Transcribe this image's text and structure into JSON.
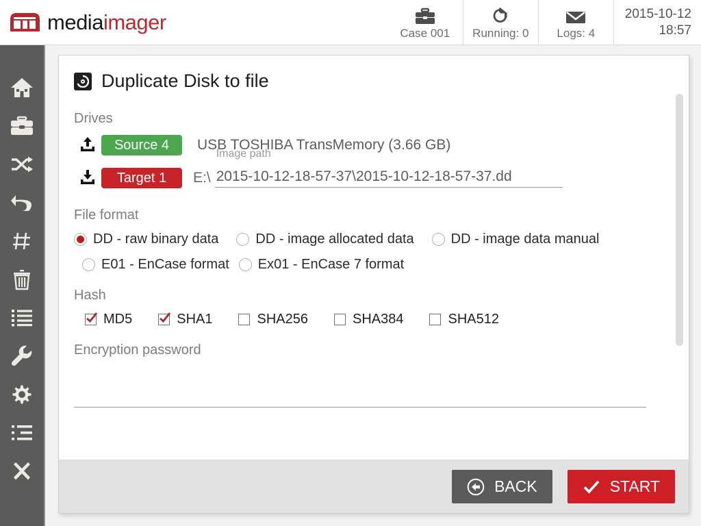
{
  "brand": {
    "name_part1": "media",
    "name_part2": "imager",
    "logo_icon": "mediaimager-logo-icon",
    "red": "#c0282f",
    "dark": "#1a1a1a"
  },
  "header": {
    "items": [
      {
        "icon": "briefcase-icon",
        "label": "Case 001"
      },
      {
        "icon": "running-refresh-icon",
        "label": "Running: 0"
      },
      {
        "icon": "envelope-icon",
        "label": "Logs: 4"
      }
    ],
    "clock": {
      "date": "2015-10-12",
      "time": "18:57"
    }
  },
  "sidebar": {
    "items": [
      {
        "icon": "home-icon",
        "name": "sidebar-item-home"
      },
      {
        "icon": "briefcase-icon",
        "name": "sidebar-item-case"
      },
      {
        "icon": "shuffle-icon",
        "name": "sidebar-item-duplicate"
      },
      {
        "icon": "undo-icon",
        "name": "sidebar-item-restore"
      },
      {
        "icon": "hash-icon",
        "name": "sidebar-item-hash"
      },
      {
        "icon": "trash-icon",
        "name": "sidebar-item-wipe"
      },
      {
        "icon": "list-icon",
        "name": "sidebar-item-logs"
      },
      {
        "icon": "wrench-icon",
        "name": "sidebar-item-tools"
      },
      {
        "icon": "gear-icon",
        "name": "sidebar-item-settings"
      },
      {
        "icon": "sliders-icon",
        "name": "sidebar-item-preferences"
      },
      {
        "icon": "close-x-icon",
        "name": "sidebar-item-exit"
      }
    ]
  },
  "dialog": {
    "title": "Duplicate Disk to file",
    "title_icon": "disk-icon",
    "drives": {
      "section_label": "Drives",
      "source": {
        "icon": "upload-icon",
        "badge": "Source 4",
        "badge_color": "#4ba64f",
        "name": "USB TOSHIBA  TransMemory (3.66 GB)"
      },
      "target": {
        "icon": "download-icon",
        "badge": "Target 1",
        "badge_color": "#c62429",
        "drive_letter": "E:\\",
        "path_hint": "Image path",
        "path_value": "2015-10-12-18-57-37\\2015-10-12-18-57-37.dd",
        "path_placeholder": "Image path"
      }
    },
    "file_format": {
      "section_label": "File format",
      "options": [
        {
          "label": "DD - raw binary data",
          "selected": true
        },
        {
          "label": "DD - image allocated data",
          "selected": false
        },
        {
          "label": "DD - image data manual",
          "selected": false
        },
        {
          "label": "E01 - EnCase format",
          "selected": false
        },
        {
          "label": "Ex01 - EnCase 7 format",
          "selected": false
        }
      ]
    },
    "hash": {
      "section_label": "Hash",
      "options": [
        {
          "label": "MD5",
          "checked": true
        },
        {
          "label": "SHA1",
          "checked": true
        },
        {
          "label": "SHA256",
          "checked": false
        },
        {
          "label": "SHA384",
          "checked": false
        },
        {
          "label": "SHA512",
          "checked": false
        }
      ]
    },
    "encryption": {
      "section_label": "Encryption password",
      "value": "",
      "placeholder": ""
    },
    "footer": {
      "back_label": "BACK",
      "back_icon": "arrow-left-circle-icon",
      "start_label": "START",
      "start_icon": "check-icon",
      "start_color": "#cc1f26"
    }
  }
}
